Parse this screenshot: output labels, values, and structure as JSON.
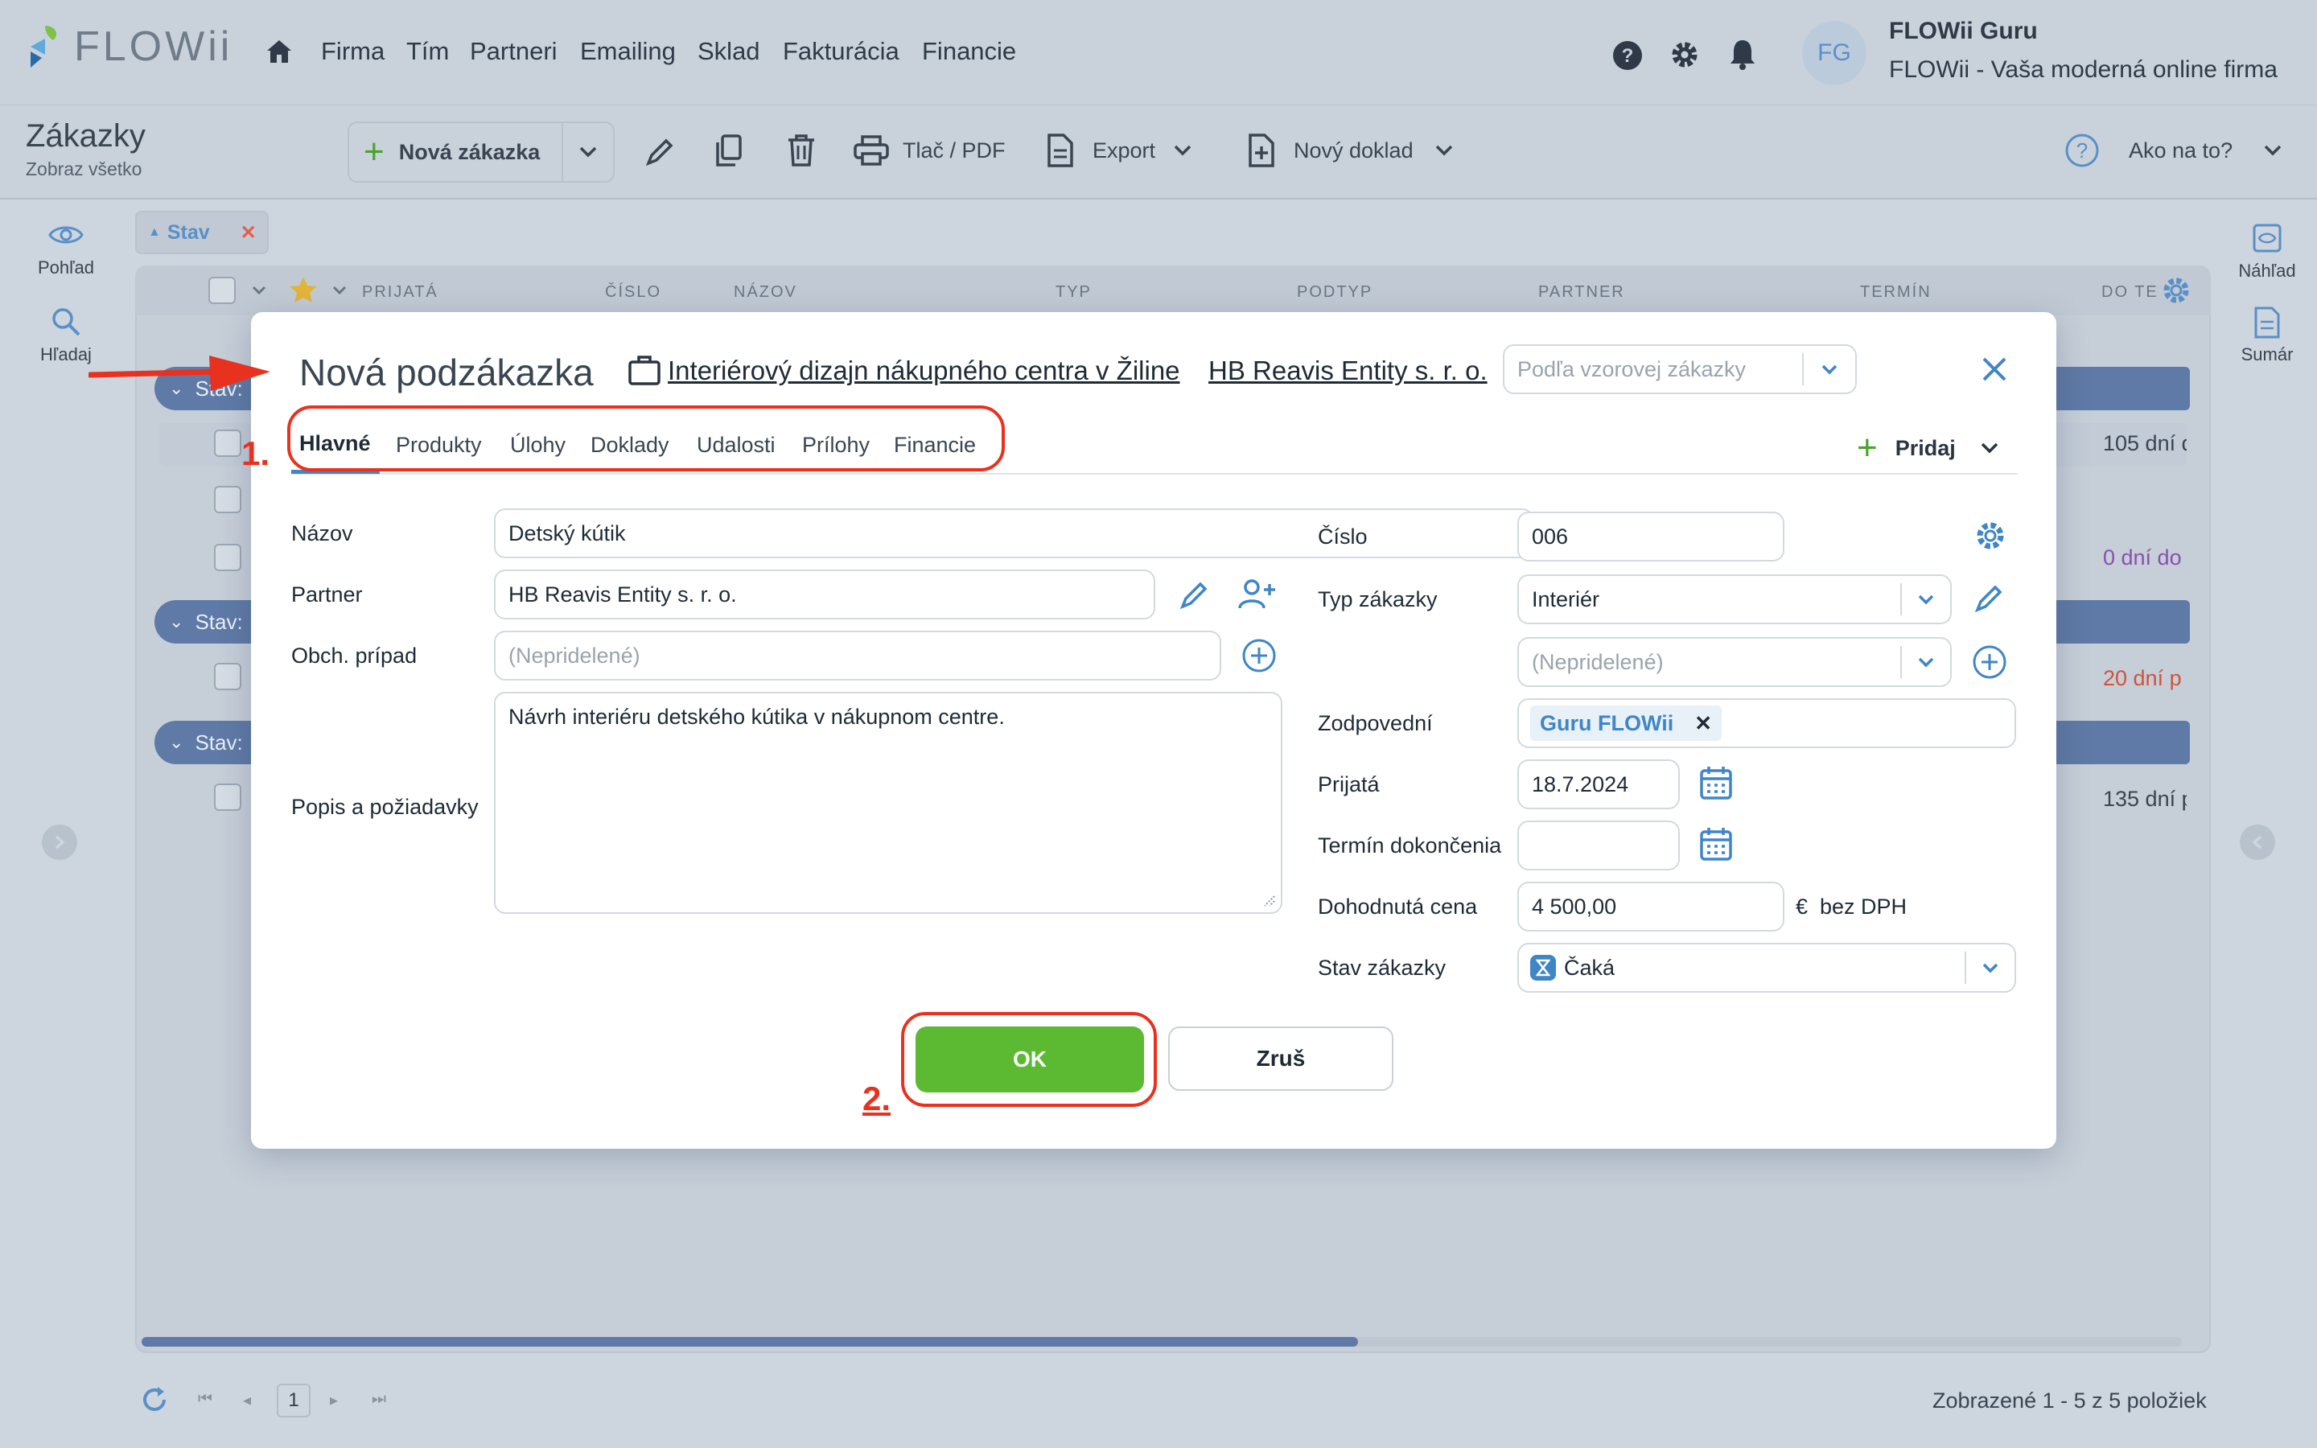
{
  "nav": {
    "brand": "FLOWii",
    "items": [
      "Firma",
      "Tím",
      "Partneri",
      "Emailing",
      "Sklad",
      "Fakturácia",
      "Financie"
    ],
    "user_initials": "FG",
    "user_name": "FLOWii Guru",
    "company": "FLOWii - Vaša moderná online firma"
  },
  "page": {
    "title": "Zákazky",
    "subtitle": "Zobraz všetko",
    "new_order_label": "Nová zákazka",
    "print_label": "Tlač / PDF",
    "export_label": "Export",
    "new_doc_label": "Nový doklad",
    "help_label": "Ako na to?"
  },
  "left_sidebar": {
    "view_label": "Pohľad",
    "search_label": "Hľadaj"
  },
  "right_sidebar": {
    "preview_label": "Náhľad",
    "summary_label": "Sumár"
  },
  "filter": {
    "chip_label": "Stav"
  },
  "table": {
    "columns": [
      "PRIJATÁ",
      "ČÍSLO",
      "NÁZOV",
      "TYP",
      "PODTYP",
      "PARTNER",
      "TERMÍN",
      "DO TE"
    ],
    "group_label": "Stav:",
    "deadlines": [
      "105 dní d",
      "0 dní do",
      "20 dní p",
      "135 dní p"
    ]
  },
  "pagination": {
    "page": "1",
    "summary": "Zobrazené 1 - 5 z 5 položiek"
  },
  "modal": {
    "title": "Nová podzákazka",
    "parent_order": "Interiérový dizajn nákupného centra v Žiline",
    "partner_link": "HB Reavis Entity s. r. o.",
    "template_placeholder": "Podľa vzorovej zákazky",
    "tabs": [
      "Hlavné",
      "Produkty",
      "Úlohy",
      "Doklady",
      "Udalosti",
      "Prílohy",
      "Financie"
    ],
    "add_label": "Pridaj",
    "left": {
      "name_label": "Názov",
      "name_value": "Detský kútik",
      "partner_label": "Partner",
      "partner_value": "HB Reavis Entity s. r. o.",
      "case_label": "Obch. prípad",
      "case_placeholder": "(Nepridelené)",
      "desc_label": "Popis a požiadavky",
      "desc_value": "Návrh interiéru detského kútika v nákupnom centre."
    },
    "right": {
      "number_label": "Číslo",
      "number_value": "006",
      "type_label": "Typ zákazky",
      "type_value": "Interiér",
      "subtype_placeholder": "(Nepridelené)",
      "resp_label": "Zodpovední",
      "resp_tag": "Guru FLOWii",
      "received_label": "Prijatá",
      "received_value": "18.7.2024",
      "deadline_label": "Termín dokončenia",
      "price_label": "Dohodnutá cena",
      "price_value": "4 500,00",
      "price_unit": "€  bez DPH",
      "status_label": "Stav zákazky",
      "status_value": "Čaká"
    },
    "ok_label": "OK",
    "cancel_label": "Zruš",
    "annotation_1": "1.",
    "annotation_2": "2."
  },
  "colors": {
    "accent_blue": "#3f86c6",
    "ok_green": "#5cb932",
    "annotation_red": "#e8321f"
  }
}
